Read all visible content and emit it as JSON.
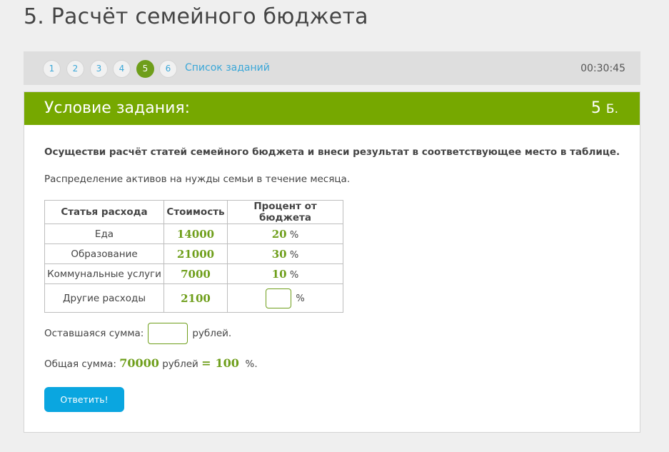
{
  "page_title": "5. Расчёт семейного бюджета",
  "nav": {
    "numbers": [
      "1",
      "2",
      "3",
      "4",
      "5",
      "6"
    ],
    "active_index": 4,
    "task_list_label": "Список заданий",
    "timer": "00:30:45"
  },
  "task": {
    "header_title": "Условие задания:",
    "points_value": "5",
    "points_unit": "Б.",
    "question": "Осуществи расчёт статей семейного бюджета и внеси результат в соответствующее место в таблице.",
    "subtitle": "Распределение активов на нужды семьи в течение месяца.",
    "table": {
      "headers": [
        "Статья расхода",
        "Стоимость",
        "Процент от бюджета"
      ],
      "rows": [
        {
          "item": "Еда",
          "cost": "14000",
          "percent": "20"
        },
        {
          "item": "Образование",
          "cost": "21000",
          "percent": "30"
        },
        {
          "item": "Коммунальные услуги",
          "cost": "7000",
          "percent": "10"
        },
        {
          "item": "Другие расходы",
          "cost": "2100",
          "percent": ""
        }
      ],
      "percent_sign": "%"
    },
    "remaining_label": "Оставшаяся сумма:",
    "remaining_unit": "рублей.",
    "remaining_value": "",
    "total_label": "Общая сумма: ",
    "total_value": "70000",
    "total_unit": " рублей ",
    "total_equals": "=",
    "total_percent": "100",
    "total_percent_sign": "  %.",
    "submit_label": "Ответить!"
  },
  "colors": {
    "accent_green": "#76a800",
    "link_blue": "#3aa7d8",
    "button_blue": "#0aa6e0"
  }
}
